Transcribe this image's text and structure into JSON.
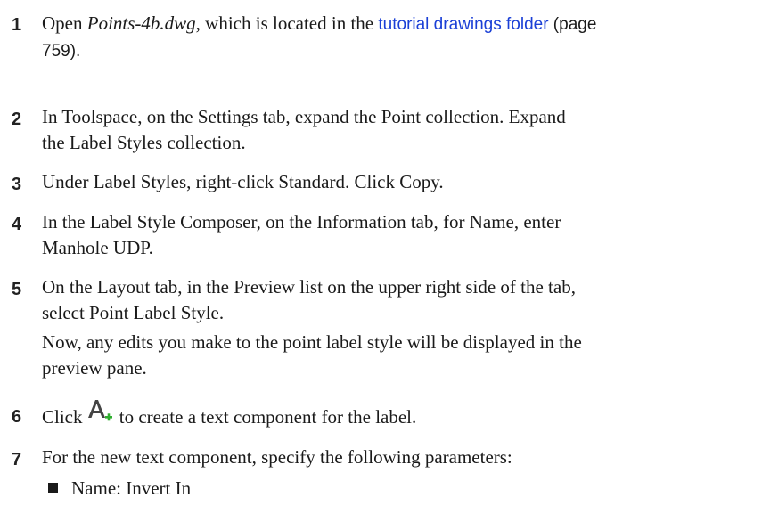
{
  "steps": [
    {
      "number": "1",
      "pre": "Open ",
      "file": "Points-4b.dwg",
      "mid": ", which is located in the ",
      "link": "tutorial drawings folder",
      "page_ref_1": " (page",
      "page_ref_2": "759",
      "end": ")."
    },
    {
      "number": "2",
      "line1": "In Toolspace, on the Settings tab, expand the Point collection. Expand",
      "line2": "the Label Styles collection."
    },
    {
      "number": "3",
      "line1": "Under Label Styles, right-click Standard. Click Copy."
    },
    {
      "number": "4",
      "line1": "In the Label Style Composer, on the Information tab, for Name, enter",
      "line2": "Manhole UDP."
    },
    {
      "number": "5",
      "line1": "On the Layout tab, in the Preview list on the upper right side of the tab,",
      "line2": "select Point Label Style.",
      "note1": "Now, any edits you make to the point label style will be displayed in the",
      "note2": "preview pane."
    },
    {
      "number": "6",
      "pre": "Click",
      "icon": "create-text-component-icon",
      "post": " to create a text component for the label."
    },
    {
      "number": "7",
      "line1": "For the new text component, specify the following parameters:",
      "bullets": [
        "Name: Invert In"
      ]
    }
  ],
  "colors": {
    "link": "#1a3fd6",
    "icon_green": "#2fae2f",
    "icon_dark": "#444444"
  }
}
